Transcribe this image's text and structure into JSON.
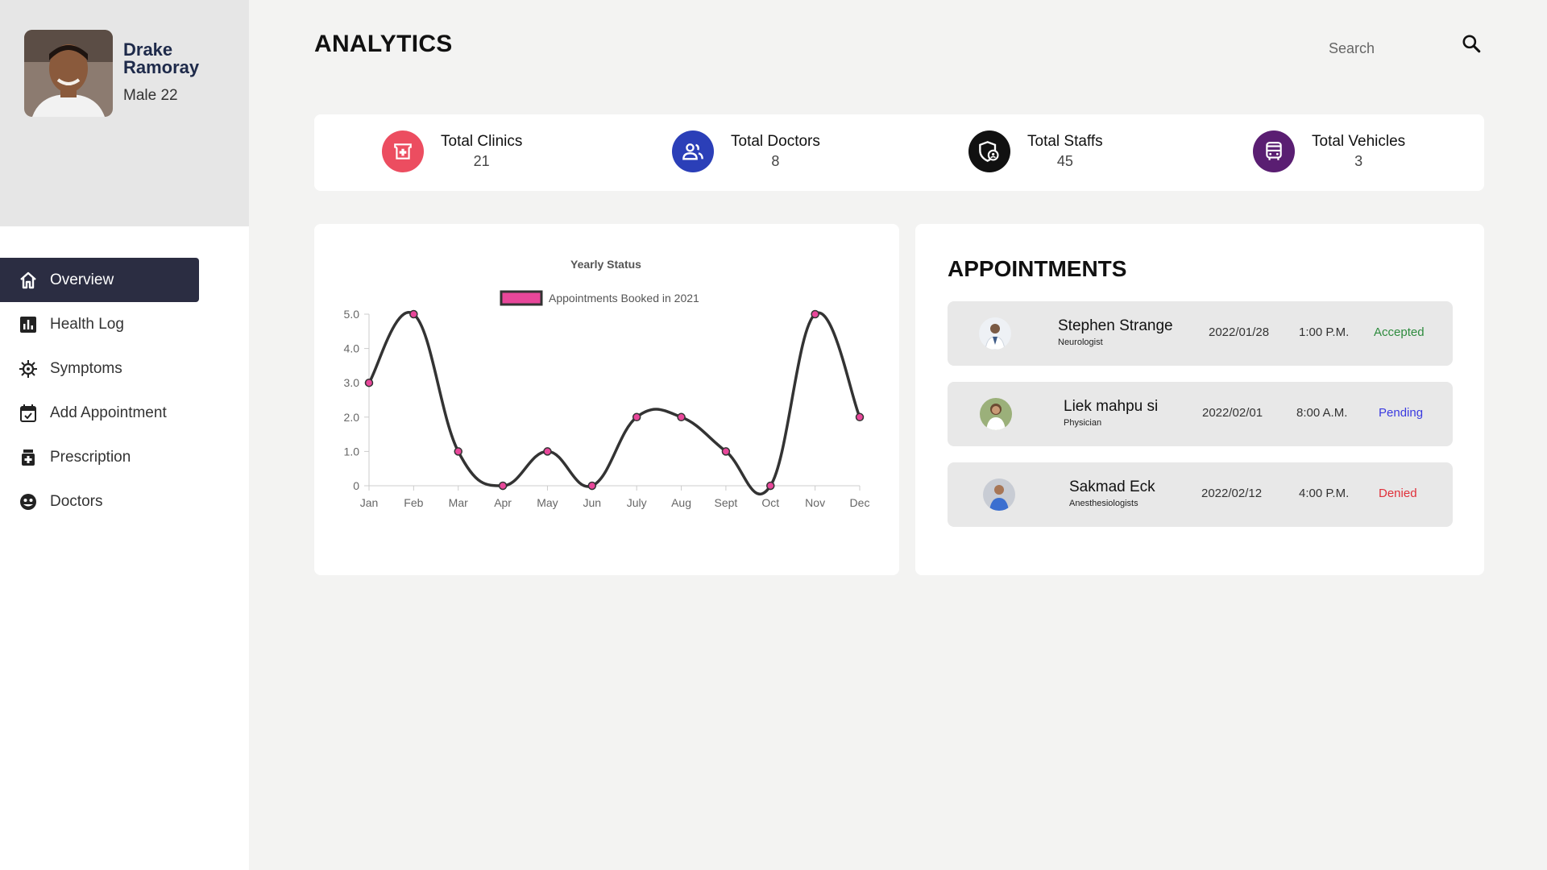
{
  "profile": {
    "first_name": "Drake",
    "last_name": "Ramoray",
    "meta": "Male 22"
  },
  "nav": {
    "items": [
      {
        "label": "Overview",
        "icon": "home-icon",
        "active": true
      },
      {
        "label": "Health Log",
        "icon": "bar-chart-icon"
      },
      {
        "label": "Symptoms",
        "icon": "virus-icon"
      },
      {
        "label": "Add Appointment",
        "icon": "calendar-check-icon"
      },
      {
        "label": "Prescription",
        "icon": "medicine-icon"
      },
      {
        "label": "Doctors",
        "icon": "face-icon"
      }
    ]
  },
  "header": {
    "title": "ANALYTICS",
    "search_placeholder": "Search"
  },
  "stats": [
    {
      "label": "Total Clinics",
      "value": "21",
      "icon": "clinic-icon",
      "color": "#ec4d60"
    },
    {
      "label": "Total Doctors",
      "value": "8",
      "icon": "people-icon",
      "color": "#2b3fb8"
    },
    {
      "label": "Total Staffs",
      "value": "45",
      "icon": "staff-shield-icon",
      "color": "#111111"
    },
    {
      "label": "Total Vehicles",
      "value": "3",
      "icon": "bus-icon",
      "color": "#5a1e72"
    }
  ],
  "chart_data": {
    "type": "line",
    "title": "Yearly Status",
    "categories": [
      "Jan",
      "Feb",
      "Mar",
      "Apr",
      "May",
      "Jun",
      "July",
      "Aug",
      "Sept",
      "Oct",
      "Nov",
      "Dec"
    ],
    "series": [
      {
        "name": "Appointments Booked in 2021",
        "values": [
          3,
          5,
          1,
          0,
          1,
          0,
          2,
          2,
          1,
          0,
          5,
          2
        ]
      }
    ],
    "y_ticks": [
      "0",
      "1.0",
      "2.0",
      "3.0",
      "4.0",
      "5.0"
    ],
    "ylim": [
      0,
      5
    ],
    "legend_position": "top",
    "line_color": "#333333",
    "point_color": "#e8479a",
    "grid": false
  },
  "appointments": {
    "title": "APPOINTMENTS",
    "items": [
      {
        "name": "Stephen Strange",
        "role": "Neurologist",
        "date": "2022/01/28",
        "time": "1:00 P.M.",
        "status": "Accepted",
        "status_color": "#2e8b3e"
      },
      {
        "name": "Liek mahpu si",
        "role": "Physician",
        "date": "2022/02/01",
        "time": "8:00 A.M.",
        "status": "Pending",
        "status_color": "#3a3ae0"
      },
      {
        "name": "Sakmad Eck",
        "role": "Anesthesiologists",
        "date": "2022/02/12",
        "time": "4:00 P.M.",
        "status": "Denied",
        "status_color": "#e0303a"
      }
    ]
  }
}
